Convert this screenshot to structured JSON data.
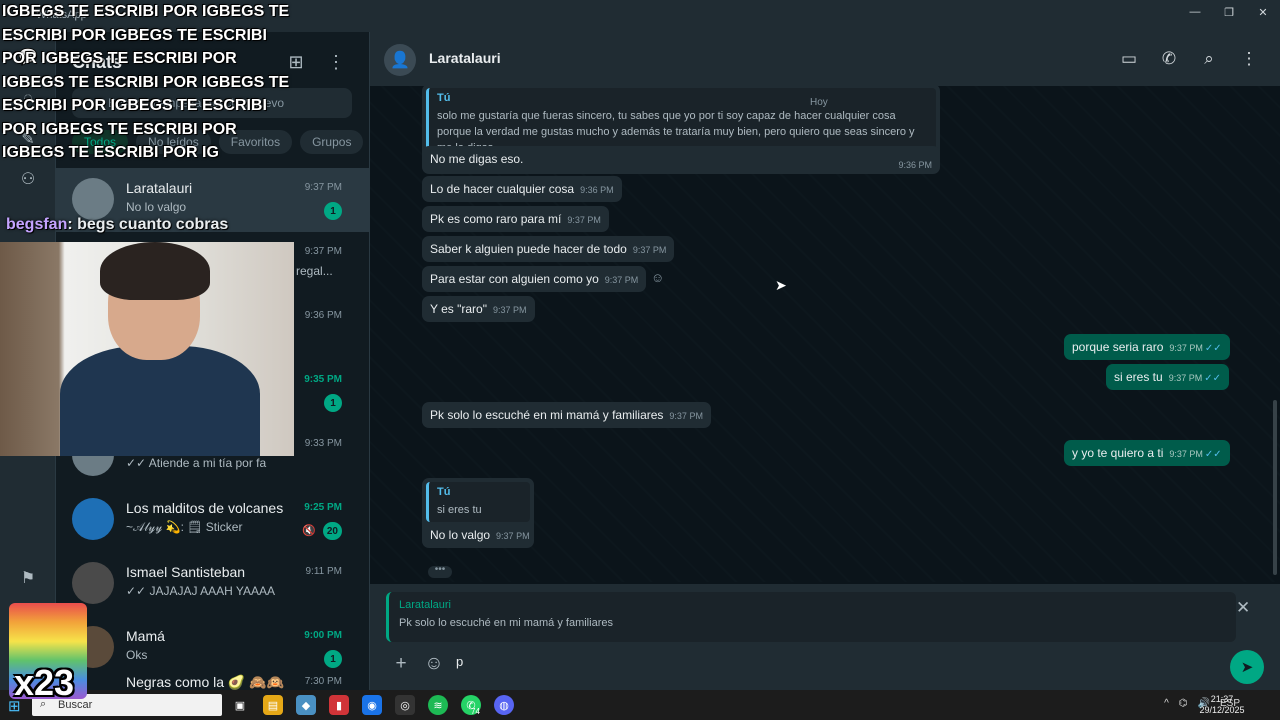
{
  "window": {
    "app_title": "WhatsApp",
    "minimize": "—",
    "maximize": "❐",
    "close": "✕"
  },
  "rail": {
    "chats_badge": "74"
  },
  "chatlist": {
    "title": "Chats",
    "search_placeholder": "Buscar o empezar un chat nuevo",
    "filters": [
      "Todos",
      "No leídos",
      "Favoritos",
      "Grupos"
    ],
    "items": [
      {
        "name": "Laratalauri",
        "preview": "No lo valgo",
        "time": "9:37 PM",
        "unread": "1",
        "time_green": false
      },
      {
        "name": "",
        "preview": "o regal...",
        "time": "9:37 PM",
        "unread": "",
        "time_green": false
      },
      {
        "name": "",
        "preview": "",
        "time": "9:36 PM",
        "unread": "",
        "time_green": false
      },
      {
        "name": "",
        "preview": "",
        "time": "9:35 PM",
        "unread": "1",
        "time_green": true
      },
      {
        "name": "",
        "preview": "✓✓ Atiende a mi tía por fa",
        "time": "9:33 PM",
        "unread": "",
        "time_green": false
      },
      {
        "name": "Los malditos de volcanes",
        "preview": "~𝒜𝓁𝓎𝓎 💫: 🗒 Sticker",
        "time": "9:25 PM",
        "unread": "20",
        "time_green": true,
        "muted": true
      },
      {
        "name": "Ismael Santisteban",
        "preview": "✓✓ JAJAJAJ AAAH YAAAA",
        "time": "9:11 PM",
        "unread": "",
        "time_green": false
      },
      {
        "name": "Mamá",
        "preview": "Oks",
        "time": "9:00 PM",
        "unread": "1",
        "time_green": true
      },
      {
        "name": "Negras como la 🥑 🙈🙉",
        "preview": "",
        "time": "7:30 PM",
        "unread": "",
        "time_green": false
      }
    ]
  },
  "chat": {
    "contact": "Laratalauri",
    "day_label": "Hoy",
    "quote1": {
      "author": "Tú",
      "text": "solo me gustaría que fueras sincero, tu sabes que yo por ti soy capaz de hacer cualquier cosa porque la verdad me gustas mucho y además te trataría muy bien, pero quiero que seas sincero y me lo digas..."
    },
    "messages": [
      {
        "text": "No me digas eso.",
        "time": "9:36 PM"
      },
      {
        "text": "Lo de hacer cualquier cosa",
        "time": "9:36 PM"
      },
      {
        "text": "Pk es como raro para mí",
        "time": "9:37 PM"
      },
      {
        "text": "Saber k alguien puede hacer de todo",
        "time": "9:37 PM"
      },
      {
        "text": "Para estar con alguien como yo",
        "time": "9:37 PM"
      },
      {
        "text": "Y es \"raro\"",
        "time": "9:37 PM"
      },
      {
        "text": "porque seria raro",
        "time": "9:37 PM"
      },
      {
        "text": "si eres tu",
        "time": "9:37 PM"
      },
      {
        "text": "Pk solo lo escuché en mi mamá y familiares",
        "time": "9:37 PM"
      },
      {
        "text": "y yo te quiero a ti",
        "time": "9:37 PM"
      },
      {
        "text": "No lo valgo",
        "time": "9:37 PM"
      }
    ],
    "quote2": {
      "author": "Tú",
      "text": "si eres tu"
    },
    "ticks": "✓✓",
    "reply": {
      "name": "Laratalauri",
      "text": "Pk solo lo escuché en mi mamá y familiares"
    },
    "input_value": "p"
  },
  "taskbar": {
    "search_label": "Buscar",
    "whatsapp_badge": "74",
    "lang": "ESP",
    "time": "21:37",
    "date": "29/12/2025"
  },
  "overlay": {
    "banner": "IGBEGS TE ESCRIBI POR IGBEGS TE ESCRIBI POR IGBEGS TE ESCRIBI POR IGBEGS TE ESCRIBI POR IGBEGS TE ESCRIBI POR IGBEGS TE ESCRIBI POR IGBEGS TE ESCRIBI POR IGBEGS TE ESCRIBI POR IGBEGS TE ESCRIBI POR IG",
    "chat_user": "begsfan",
    "chat_text": ": begs cuanto cobras",
    "emote_count": "x23"
  },
  "colors": {
    "accent": "#00a884",
    "outgoing": "#005c4b",
    "incoming": "#202c33",
    "background": "#0b141a",
    "read_ticks": "#53bdeb"
  }
}
